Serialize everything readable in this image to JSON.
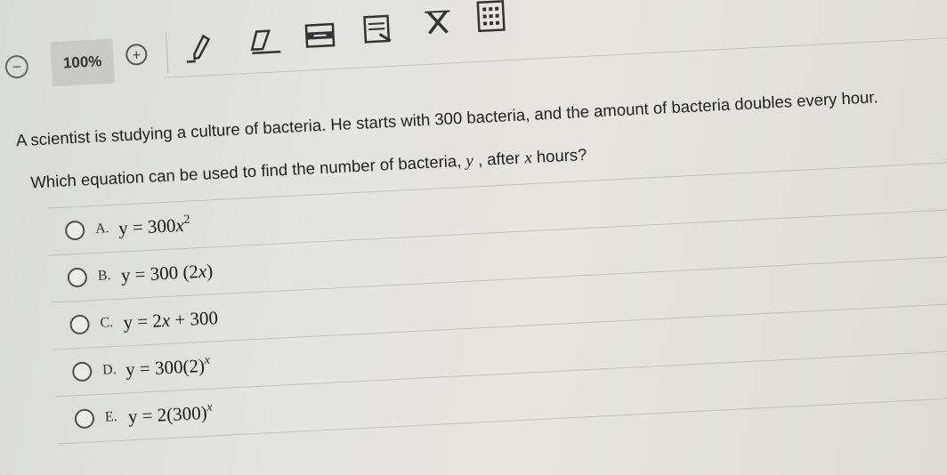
{
  "toolbar": {
    "zoom_out_icon": "zoom-out-icon",
    "zoom_level": "100%",
    "zoom_in_icon": "zoom-in-icon",
    "tools": [
      {
        "name": "pen-icon"
      },
      {
        "name": "eraser-icon"
      },
      {
        "name": "highlighter-icon"
      },
      {
        "name": "notes-icon"
      },
      {
        "name": "answer-eliminator-icon"
      },
      {
        "name": "calculator-icon"
      }
    ]
  },
  "question": {
    "stem": "A scientist is studying a culture of bacteria. He starts with 300 bacteria, and the amount of bacteria doubles every hour.",
    "prompt_before_y": "Which equation can be used to find the number of bacteria, ",
    "var_y": "y",
    "prompt_middle": " , after ",
    "var_x": "x",
    "prompt_after": " hours?"
  },
  "choices": [
    {
      "letter": "A.",
      "lhs": "y = 300",
      "var": "x",
      "exp": "2",
      "rest": ""
    },
    {
      "letter": "B.",
      "lhs": "y = 300 (2",
      "var": "x",
      "exp": "",
      "rest": ")"
    },
    {
      "letter": "C.",
      "lhs": "y = 2",
      "var": "x",
      "exp": "",
      "rest": " + 300"
    },
    {
      "letter": "D.",
      "lhs": "y = 300(2)",
      "var": "",
      "exp": "x",
      "rest": ""
    },
    {
      "letter": "E.",
      "lhs": "y = 2(300)",
      "var": "",
      "exp": "x",
      "rest": ""
    }
  ],
  "colors": {
    "background": "#e4e4e0",
    "text": "#1f1f1f",
    "zoom_box": "#c9c9c6"
  }
}
